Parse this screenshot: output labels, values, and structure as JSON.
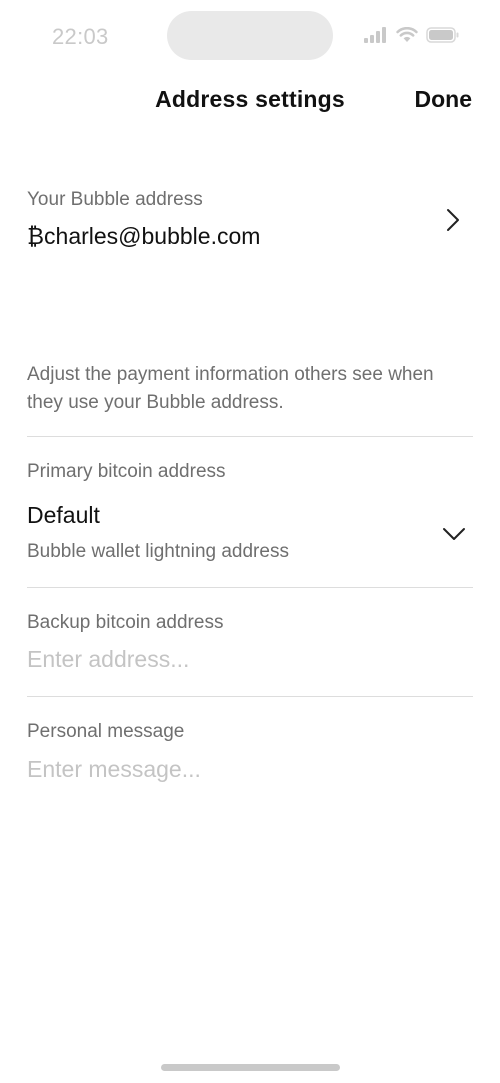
{
  "status_bar": {
    "time": "22:03",
    "icons": [
      "signal-icon",
      "wifi-icon",
      "battery-icon"
    ]
  },
  "nav": {
    "title": "Address settings",
    "done_label": "Done"
  },
  "bubble_address": {
    "label": "Your Bubble address",
    "value": "₿charles@bubble.com"
  },
  "description": "Adjust the payment information others see when they use your Bubble address.",
  "primary_bitcoin": {
    "label": "Primary bitcoin address",
    "selected_value": "Default",
    "selected_subtitle": "Bubble wallet lightning address"
  },
  "backup_bitcoin": {
    "label": "Backup bitcoin address",
    "value": "",
    "placeholder": "Enter address..."
  },
  "personal_message": {
    "label": "Personal message",
    "value": "",
    "placeholder": "Enter message..."
  },
  "colors": {
    "text_primary": "#111111",
    "text_secondary": "#6f6f6f",
    "placeholder": "#c4c4c4",
    "divider": "#dddddd",
    "status_gray": "#c9c9c9"
  }
}
